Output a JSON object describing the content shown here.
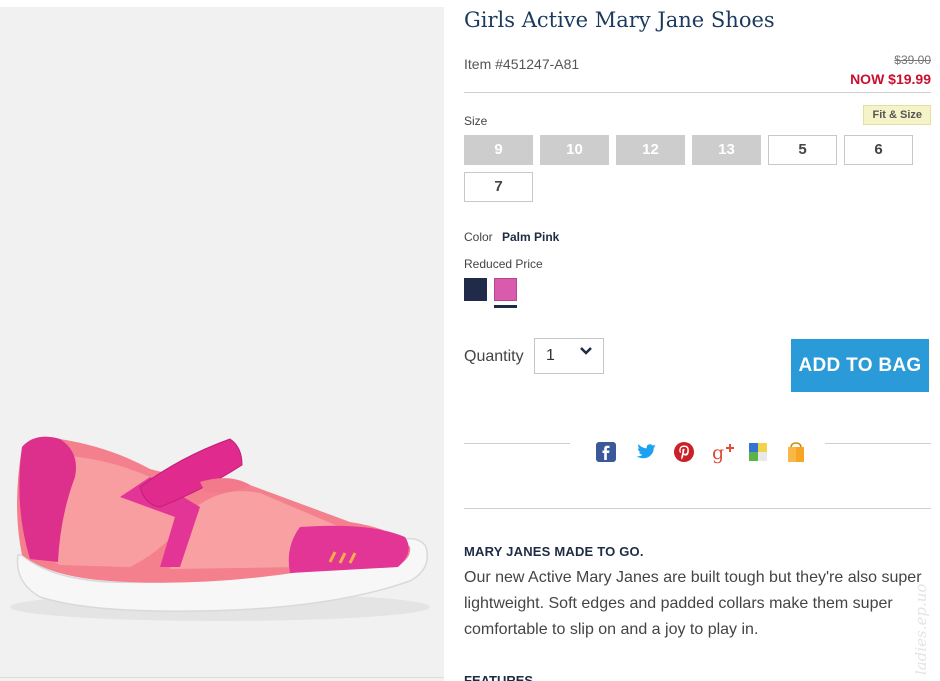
{
  "product": {
    "title": "Girls Active Mary Jane Shoes",
    "item_number": "Item #451247-A81",
    "price_was": "$39.00",
    "price_now": "NOW $19.99"
  },
  "size": {
    "label": "Size",
    "fit_size_link": "Fit & Size",
    "options": [
      {
        "label": "9",
        "available": false
      },
      {
        "label": "10",
        "available": false
      },
      {
        "label": "12",
        "available": false
      },
      {
        "label": "13",
        "available": false
      },
      {
        "label": "5",
        "available": true
      },
      {
        "label": "6",
        "available": true
      },
      {
        "label": "7",
        "available": true
      }
    ]
  },
  "color": {
    "label": "Color",
    "selected": "Palm Pink",
    "group_label": "Reduced Price",
    "swatches": [
      {
        "name": "navy",
        "hex": "#1f2b48",
        "selected": false
      },
      {
        "name": "palm-pink",
        "hex": "#d85bad",
        "selected": true
      }
    ]
  },
  "quantity": {
    "label": "Quantity",
    "value": "1"
  },
  "add_to_bag": "ADD TO BAG",
  "share": {
    "icons": [
      "facebook-icon",
      "twitter-icon",
      "pinterest-icon",
      "google-plus-icon",
      "delicious-icon",
      "shopping-bag-icon"
    ],
    "colors": {
      "facebook": "#3b5998",
      "twitter": "#1da1f2",
      "pinterest": "#cb2027",
      "google_plus": "#dd4b39"
    }
  },
  "description": {
    "heading": "MARY JANES MADE TO GO.",
    "body": "Our new Active Mary Janes are built tough but they're also super lightweight. Soft edges and padded collars make them super comfortable to slip on and a joy to play in.",
    "next_heading": "FEATURES"
  },
  "watermark": "ladies.ep.uo"
}
